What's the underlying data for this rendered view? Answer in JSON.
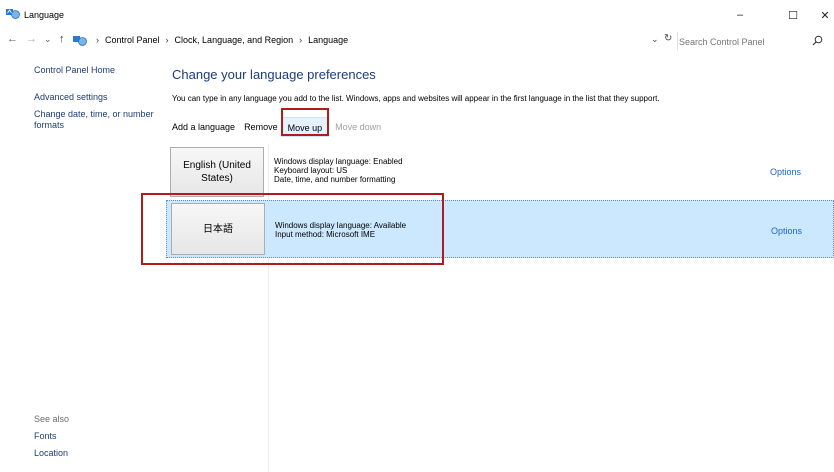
{
  "window": {
    "title": "Language",
    "minimize": "–",
    "maximize": "☐",
    "close": "✕"
  },
  "address": {
    "back": "←",
    "forward": "→",
    "recent": "⌄",
    "up": "↑",
    "crumbs": [
      "Control Panel",
      "Clock, Language, and Region",
      "Language"
    ],
    "search_placeholder": "Search Control Panel"
  },
  "left_pane": {
    "links": [
      "Control Panel Home",
      "Advanced settings",
      "Change date, time, or number formats"
    ],
    "see_also_heading": "See also",
    "see_also_links": [
      "Fonts",
      "Location"
    ]
  },
  "main": {
    "heading": "Change your language preferences",
    "description": "You can type in any language you add to the list. Windows, apps and websites will appear in the first language in the list that they support.",
    "toolbar": {
      "add": "Add a language",
      "remove": "Remove",
      "move_up": "Move up",
      "move_down": "Move down"
    },
    "languages": [
      {
        "name": "English (United States)",
        "details": [
          "Windows display language: Enabled",
          "Keyboard layout: US",
          "Date, time, and number formatting"
        ],
        "options": "Options"
      },
      {
        "name": "日本語",
        "details": [
          "Windows display language: Available",
          "Input method: Microsoft IME"
        ],
        "options": "Options"
      }
    ]
  },
  "colors": {
    "link": "#1e3c78",
    "options_link": "#1e64c8",
    "selected_row": "#cce8ff",
    "highlight": "#b01c1c"
  }
}
